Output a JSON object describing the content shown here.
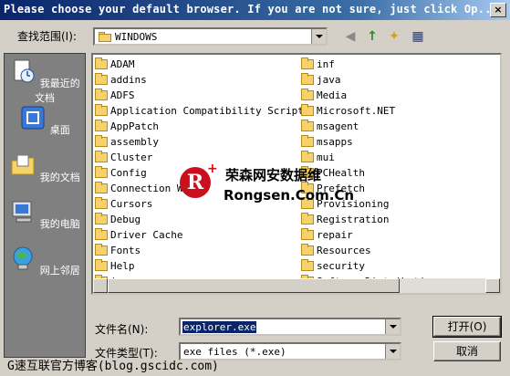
{
  "window": {
    "title": "Please choose your default browser. If you are not sure, just click Op...",
    "close_glyph": "×"
  },
  "lookin": {
    "label": "查找范围(I):",
    "value": "WINDOWS"
  },
  "toolbar": {
    "back_glyph": "◀",
    "up_glyph": "↑",
    "newfolder_glyph": "✦",
    "view_glyph": "▦"
  },
  "places": [
    {
      "label": "我最近的文档",
      "icon": "recent-docs-icon"
    },
    {
      "label": "桌面",
      "icon": "desktop-icon"
    },
    {
      "label": "我的文档",
      "icon": "my-documents-icon"
    },
    {
      "label": "我的电脑",
      "icon": "my-computer-icon"
    },
    {
      "label": "网上邻居",
      "icon": "network-icon"
    }
  ],
  "files": {
    "col1": [
      "ADAM",
      "addins",
      "ADFS",
      "Application Compatibility Scripts",
      "AppPatch",
      "assembly",
      "Cluster",
      "Config",
      "Connection Wi",
      "Cursors",
      "Debug",
      "Driver Cache",
      "Fonts",
      "Help",
      "ime"
    ],
    "col2": [
      "inf",
      "java",
      "Media",
      "Microsoft.NET",
      "msagent",
      "msapps",
      "mui",
      "PCHealth",
      "Prefetch",
      "Provisioning",
      "Registration",
      "repair",
      "Resources",
      "security",
      "SoftwareDistribution"
    ]
  },
  "filename": {
    "label": "文件名(N):",
    "value": "explorer.exe"
  },
  "filetype": {
    "label": "文件类型(T):",
    "value": "exe files (*.exe)"
  },
  "buttons": {
    "open": "打开(O)",
    "cancel": "取消"
  },
  "watermark": {
    "logo": "R",
    "plus": "+",
    "cn": "荣森网安数据维",
    "en": "Rongsen.Com.Cn"
  },
  "footer_watermark": "G速互联官方博客(blog.gscidc.com)",
  "colors": {
    "titlebar": "#0a246a",
    "places_bg": "#808080",
    "selection": "#0a246a",
    "brand_red": "#c8101e"
  }
}
